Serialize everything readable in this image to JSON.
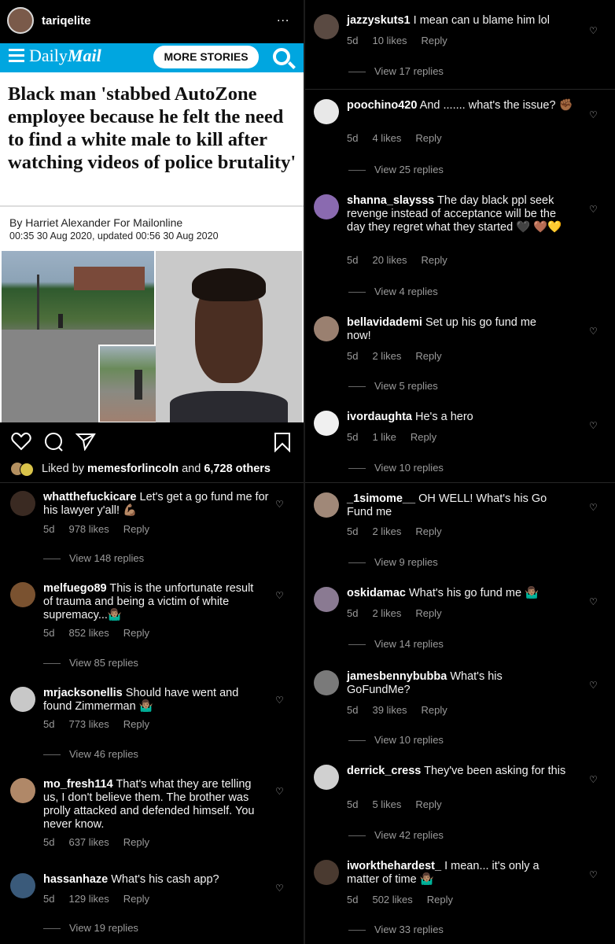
{
  "post": {
    "username": "tariqelite",
    "more": "...",
    "liked_by": "Liked by",
    "liked_user": "memesforlincoln",
    "liked_and": "and",
    "liked_count": "6,728 others"
  },
  "article": {
    "brand": "Daily",
    "brand2": "Mail",
    "more_stories": "MORE STORIES",
    "headline": "Black man 'stabbed AutoZone employee because he felt the need to find a white male to kill after watching videos of police brutality'",
    "byline": "By Harriet Alexander For Mailonline",
    "dateline": "00:35 30 Aug 2020, updated 00:56 30 Aug 2020"
  },
  "left_comments": [
    {
      "user": "whatthefuckicare",
      "text": "Let's get a go fund me for his lawyer y'all! 💪🏽",
      "age": "5d",
      "likes": "978 likes",
      "reply": "Reply",
      "view": "View 148 replies"
    },
    {
      "user": "melfuego89",
      "text": "This is the unfortunate result of trauma and being a victim of white supremacy...🤷🏽‍♂️",
      "age": "5d",
      "likes": "852 likes",
      "reply": "Reply",
      "view": "View 85 replies"
    },
    {
      "user": "mrjacksonellis",
      "text": "Should have went and found Zimmerman 🤷🏽‍♂️",
      "age": "5d",
      "likes": "773 likes",
      "reply": "Reply",
      "view": "View 46 replies"
    },
    {
      "user": "mo_fresh114",
      "text": "That's what they are telling us, I don't believe them. The brother was prolly attacked and defended himself. You never know.",
      "age": "5d",
      "likes": "637 likes",
      "reply": "Reply",
      "view": ""
    },
    {
      "user": "hassanhaze",
      "text": "What's his cash app?",
      "age": "5d",
      "likes": "129 likes",
      "reply": "Reply",
      "view": "View 19 replies"
    }
  ],
  "right_comments": [
    {
      "user": "jazzyskuts1",
      "text": "I mean can u blame him lol",
      "age": "5d",
      "likes": "10 likes",
      "reply": "Reply",
      "view": "View 17 replies"
    },
    {
      "user": "poochino420",
      "text": "And ....... what's the issue? ✊🏾",
      "age": "5d",
      "likes": "4 likes",
      "reply": "Reply",
      "view": "View 25 replies"
    },
    {
      "user": "shanna_slaysss",
      "text": "The day black ppl seek revenge instead of acceptance will be the day they regret what they started 🖤 🤎💛",
      "age": "5d",
      "likes": "20 likes",
      "reply": "Reply",
      "view": "View 4 replies"
    },
    {
      "user": "bellavidademi",
      "text": "Set up his go fund me now!",
      "age": "5d",
      "likes": "2 likes",
      "reply": "Reply",
      "view": "View 5 replies"
    },
    {
      "user": "ivordaughta",
      "text": "He's a hero",
      "age": "5d",
      "likes": "1 like",
      "reply": "Reply",
      "view": "View 10 replies"
    },
    {
      "user": "_1simome__",
      "text": "OH WELL! What's his Go Fund me",
      "age": "5d",
      "likes": "2 likes",
      "reply": "Reply",
      "view": "View 9 replies"
    },
    {
      "user": "oskidamac",
      "text": "What's his go fund me 🤷🏽‍♂️",
      "age": "5d",
      "likes": "2 likes",
      "reply": "Reply",
      "view": "View 14 replies"
    },
    {
      "user": "jamesbennybubba",
      "text": "What's his GoFundMe?",
      "age": "5d",
      "likes": "39 likes",
      "reply": "Reply",
      "view": "View 10 replies"
    },
    {
      "user": "derrick_cress",
      "text": "They've been asking for this",
      "age": "5d",
      "likes": "5 likes",
      "reply": "Reply",
      "view": "View 42 replies"
    },
    {
      "user": "iworkthehardest_",
      "text": "I mean... it's only a matter of time 🤷🏽‍♂️",
      "age": "5d",
      "likes": "502 likes",
      "reply": "Reply",
      "view": "View 33 replies"
    }
  ]
}
